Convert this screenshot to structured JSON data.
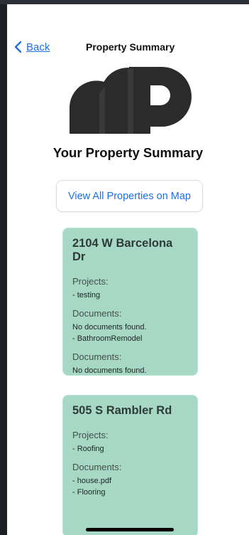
{
  "nav": {
    "back_label": "Back",
    "title": "Property Summary"
  },
  "heading": "Your Property Summary",
  "map_button_label": "View All Properties on Map",
  "properties": [
    {
      "address": "2104 W Barcelona Dr",
      "sections": [
        {
          "heading": "Projects:",
          "lines": [
            "- testing"
          ]
        },
        {
          "heading": "Documents:",
          "lines": [
            "No documents found.",
            "- BathroomRemodel"
          ]
        },
        {
          "heading": "Documents:",
          "lines": [
            "No documents found."
          ]
        }
      ]
    },
    {
      "address": "505 S Rambler Rd",
      "sections": [
        {
          "heading": "Projects:",
          "lines": [
            "- Roofing"
          ]
        },
        {
          "heading": "Documents:",
          "lines": [
            "- house.pdf",
            "- Flooring"
          ]
        }
      ]
    }
  ],
  "colors": {
    "accent": "#1f6fe5",
    "card": "#a7d8c5",
    "logo": "#2b2b2b"
  },
  "icons": {
    "back": "chevron-left-icon",
    "logo": "app-logo"
  }
}
